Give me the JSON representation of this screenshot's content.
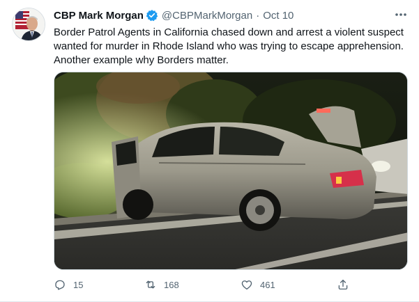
{
  "tweet": {
    "author_name": "CBP Mark Morgan",
    "handle": "@CBPMarkMorgan",
    "separator": "·",
    "date": "Oct 10",
    "text": "Border Patrol Agents in California chased down and arrest a violent suspect wanted for murder in Rhode Island who was trying to escape apprehension. Another example why Borders matter.",
    "verified": true,
    "media": "night photo of a silver sedan with open doors and trunk stopped on a curb beside bushes"
  },
  "actions": {
    "replies": "15",
    "retweets": "168",
    "likes": "461"
  },
  "icons": {
    "more": "more-options-icon",
    "verified": "verified-badge-icon",
    "reply": "reply-icon",
    "retweet": "retweet-icon",
    "like": "heart-icon",
    "share": "share-icon"
  },
  "colors": {
    "verified_blue": "#1d9bf0",
    "secondary_text": "#536471",
    "primary_text": "#0f1419"
  }
}
